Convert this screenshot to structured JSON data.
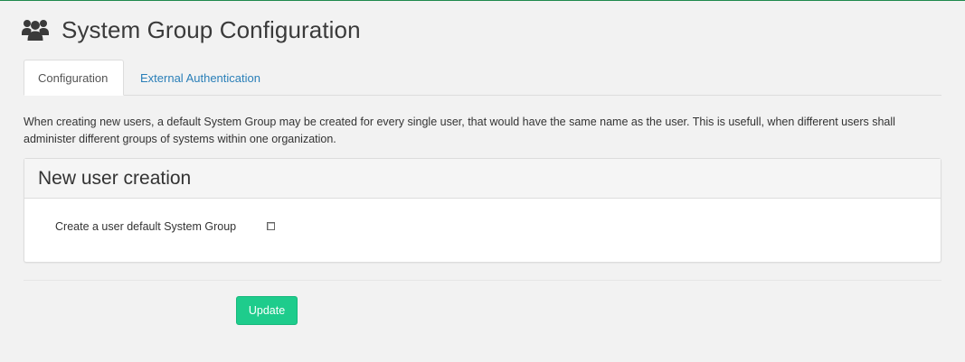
{
  "header": {
    "title": "System Group Configuration",
    "icon": "users-icon"
  },
  "tabs": [
    {
      "label": "Configuration",
      "active": true
    },
    {
      "label": "External Authentication",
      "active": false
    }
  ],
  "description": "When creating new users, a default System Group may be created for every single user, that would have the same name as the user. This is usefull, when different users shall administer different groups of systems within one organization.",
  "panel": {
    "title": "New user creation",
    "fields": [
      {
        "label": "Create a user default System Group",
        "type": "checkbox",
        "checked": false
      }
    ]
  },
  "actions": {
    "update_label": "Update"
  },
  "colors": {
    "accent": "#1f8a4c",
    "button": "#1ecc8c",
    "link": "#2a7fb8"
  }
}
